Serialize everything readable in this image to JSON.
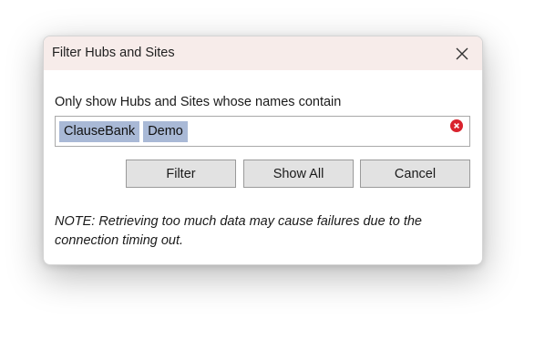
{
  "dialog": {
    "title": "Filter Hubs and Sites",
    "prompt": "Only show Hubs and Sites whose names contain",
    "filter_tags": [
      "ClauseBank",
      "Demo"
    ],
    "buttons": {
      "filter": "Filter",
      "show_all": "Show All",
      "cancel": "Cancel"
    },
    "note": "NOTE: Retrieving too much data may cause failures due to the connection timing out."
  },
  "icons": {
    "close": "close-icon",
    "clear": "clear-circle-icon"
  },
  "colors": {
    "titlebar_bg": "#f7ecea",
    "tag_bg": "#a9b9d6",
    "clear_icon": "#d9232e",
    "button_bg": "#e2e2e2"
  }
}
